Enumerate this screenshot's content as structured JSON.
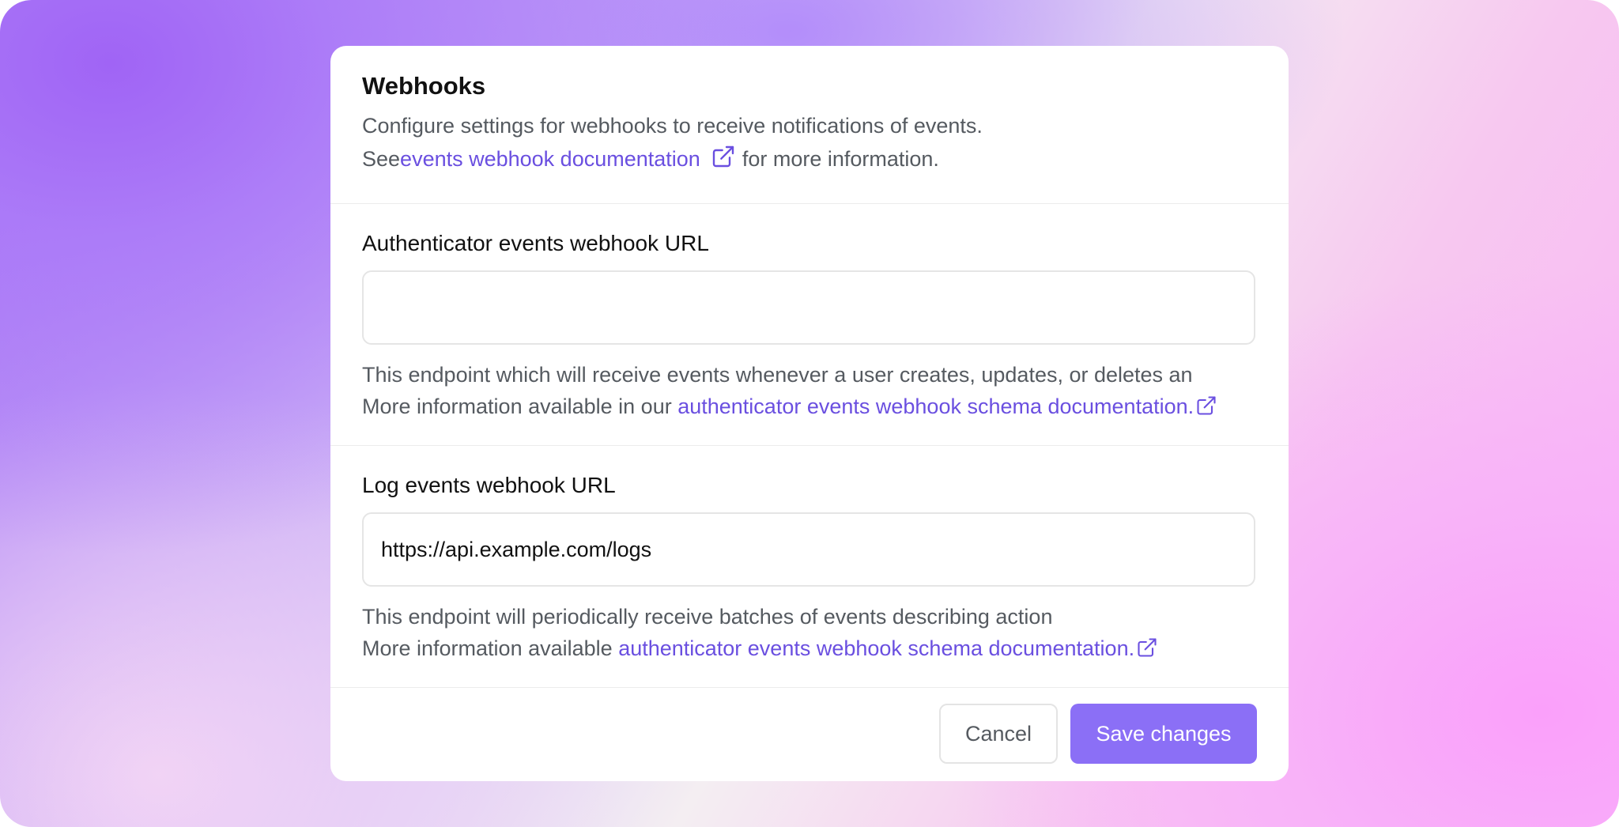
{
  "card": {
    "title": "Webhooks",
    "description_line1": "Configure settings for webhooks to receive notifications of events.",
    "description_prefix": "See",
    "description_link": "events webhook documentation",
    "description_suffix": "for more information."
  },
  "auth_field": {
    "label": "Authenticator events webhook URL",
    "value": "",
    "placeholder": "",
    "help_line1": "This endpoint which will receive events whenever a user creates, updates, or deletes an",
    "help_prefix": "More information available in our",
    "help_link": "authenticator events webhook schema documentation."
  },
  "log_field": {
    "label": "Log events webhook URL",
    "value": "https://api.example.com/logs",
    "placeholder": "",
    "help_line1": "This endpoint will periodically receive batches of events describing action",
    "help_prefix": "More information available",
    "help_link": "authenticator events webhook schema documentation."
  },
  "footer": {
    "cancel_label": "Cancel",
    "save_label": "Save changes"
  },
  "colors": {
    "accent": "#6a4fe0",
    "primary_button": "#8b6ff6"
  },
  "icons": {
    "external_link": "external-link-icon"
  }
}
